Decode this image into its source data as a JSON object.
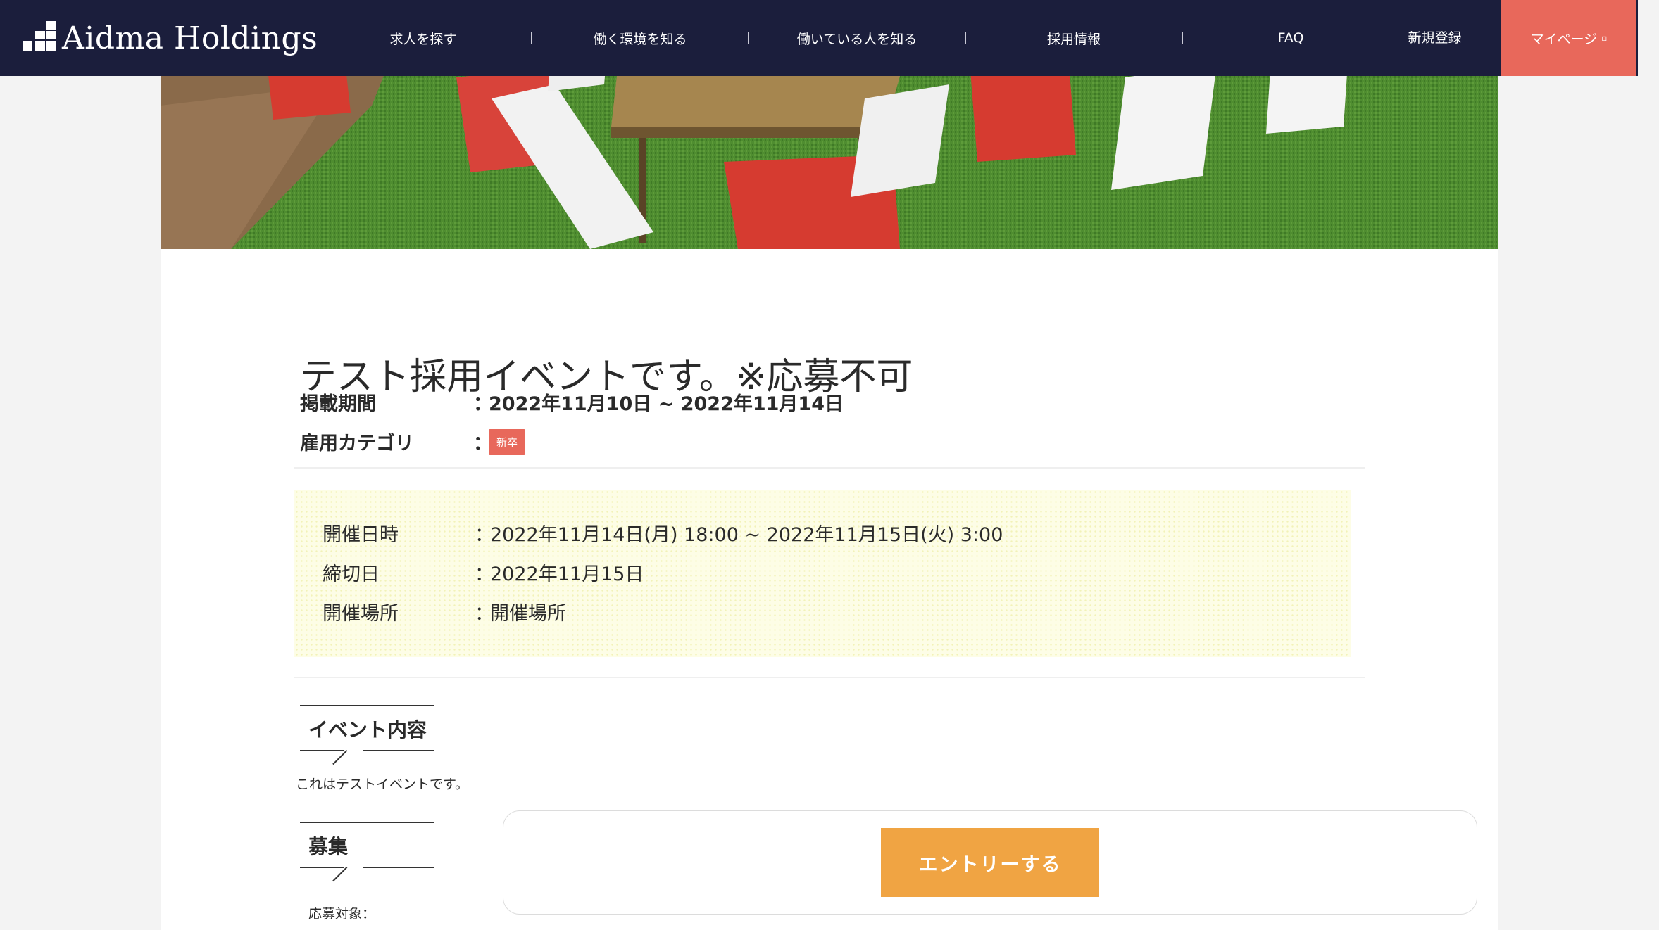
{
  "header": {
    "logo_text": "Aidma Holdings",
    "nav": [
      {
        "label": "求人を探す"
      },
      {
        "label": "働く環境を知る"
      },
      {
        "label": "働いている人を知る"
      },
      {
        "label": "採用情報"
      },
      {
        "label": "FAQ"
      }
    ],
    "register_label": "新規登録",
    "mypage_label": "マイページ"
  },
  "event": {
    "title": "テスト採用イベントです。※応募不可",
    "listing_period_label": "掲載期間",
    "listing_period_value": "2022年11月10日 ~ 2022年11月14日",
    "category_label": "雇用カテゴリ",
    "category_badge": "新卒",
    "colon": "：",
    "details": {
      "datetime_label": "開催日時",
      "datetime_value": "2022年11月14日(月) 18:00 ~ 2022年11月15日(火) 3:00",
      "deadline_label": "締切日",
      "deadline_value": "2022年11月15日",
      "venue_label": "開催場所",
      "venue_value": "開催場所"
    }
  },
  "sections": {
    "event_content_title": "イベント内容",
    "event_content_body": "これはテストイベントです。",
    "recruit_title": "募集",
    "apply_target": "応募対象："
  },
  "entry": {
    "button_label": "エントリーする"
  },
  "colors": {
    "header_bg": "#1b1e3c",
    "accent_red": "#e8685b",
    "entry_orange": "#f0a443"
  }
}
